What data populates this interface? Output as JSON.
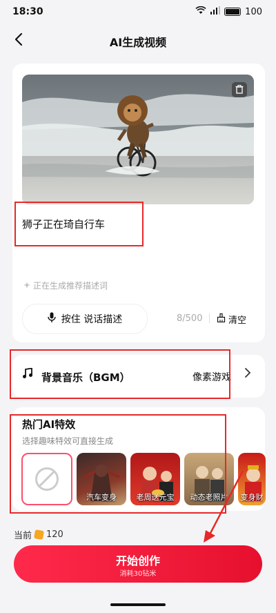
{
  "status_bar": {
    "time": "18:30",
    "battery": "100"
  },
  "header": {
    "title": "AI生成视频"
  },
  "prompt": {
    "text": "狮子正在琦自行车"
  },
  "suggest": {
    "text": "正在生成推荐描述词"
  },
  "voice": {
    "label": "按住 说话描述"
  },
  "counter": {
    "text": "8/500"
  },
  "clear": {
    "label": "清空"
  },
  "bgm": {
    "label": "背景音乐（BGM）",
    "value": "像素游戏"
  },
  "effects": {
    "title": "热门AI特效",
    "subtitle": "选择趣味特效可直接生成",
    "items": [
      {
        "label": "汽车变身"
      },
      {
        "label": "老周送元宝"
      },
      {
        "label": "动态老照片"
      },
      {
        "label": "变身财"
      }
    ]
  },
  "balance": {
    "label": "当前",
    "amount": "120"
  },
  "start": {
    "label": "开始创作",
    "sub": "消耗30钻米"
  },
  "colors": {
    "accent": "#e6102e",
    "annotation": "#e62828"
  }
}
